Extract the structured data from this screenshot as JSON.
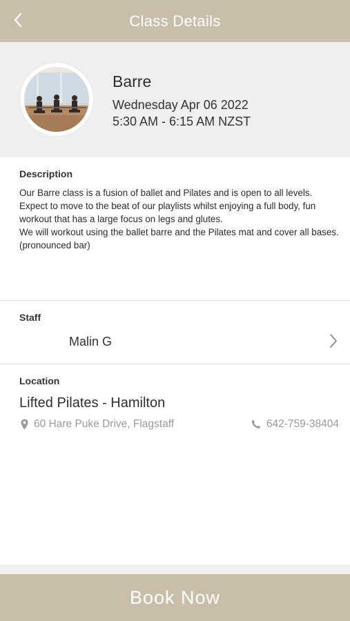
{
  "header": {
    "title": "Class Details"
  },
  "class_info": {
    "name": "Barre",
    "date": "Wednesday Apr 06 2022",
    "time": "5:30 AM - 6:15 AM NZST"
  },
  "description": {
    "label": "Description",
    "text": "Our Barre class is a fusion of ballet and Pilates and is open to all levels. Expect to move to the beat of our playlists whilst enjoying a full body, fun workout that has a large focus on legs and glutes.\nWe will workout using the ballet barre and the Pilates mat and cover all bases.\n(pronounced bar)"
  },
  "staff": {
    "label": "Staff",
    "name": "Malin G"
  },
  "location": {
    "label": "Location",
    "name": "Lifted Pilates - Hamilton",
    "address": "60 Hare Puke Drive, Flagstaff",
    "phone": "642-759-38404"
  },
  "actions": {
    "book_label": "Book Now"
  },
  "colors": {
    "accent": "#c9bea9",
    "hero_bg": "#efefef",
    "muted_text": "#9a9a9a"
  },
  "icons": {
    "back": "chevron-left-icon",
    "staff_arrow": "chevron-right-icon",
    "address": "map-pin-icon",
    "phone": "phone-icon"
  }
}
